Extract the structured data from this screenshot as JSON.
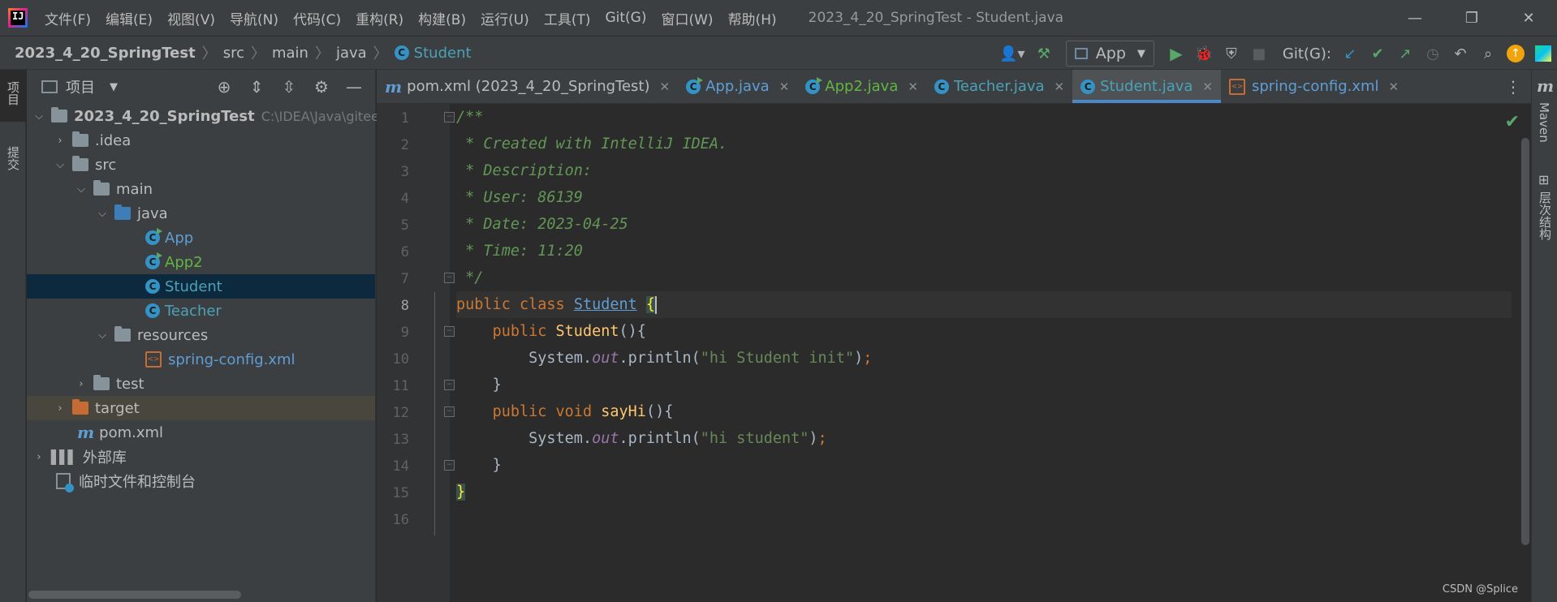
{
  "menubar": {
    "items": [
      "文件(F)",
      "编辑(E)",
      "视图(V)",
      "导航(N)",
      "代码(C)",
      "重构(R)",
      "构建(B)",
      "运行(U)",
      "工具(T)",
      "Git(G)",
      "窗口(W)",
      "帮助(H)"
    ],
    "title": "2023_4_20_SpringTest - Student.java",
    "minimize": "—",
    "restore": "❐",
    "close": "✕"
  },
  "breadcrumb": {
    "project": "2023_4_20_SpringTest",
    "items": [
      "src",
      "main",
      "java"
    ],
    "current": "Student"
  },
  "toolbar": {
    "run_config": "App",
    "git_label": "Git(G):"
  },
  "left_strip": {
    "project_tab": "项目",
    "commit_tab": "提交"
  },
  "right_strip": {
    "maven_tab": "Maven",
    "structure_tab": "层次结构"
  },
  "project_panel": {
    "title": "项目",
    "root_name": "2023_4_20_SpringTest",
    "root_path": "C:\\IDEA\\Java\\gitee",
    "nodes": {
      "idea": ".idea",
      "src": "src",
      "main": "main",
      "java": "java",
      "app": "App",
      "app2": "App2",
      "student": "Student",
      "teacher": "Teacher",
      "resources": "resources",
      "spring_config": "spring-config.xml",
      "test": "test",
      "target": "target",
      "pom": "pom.xml",
      "external_libs": "外部库",
      "scratches": "临时文件和控制台"
    }
  },
  "tabs": [
    {
      "label": "pom.xml (2023_4_20_SpringTest)",
      "icon": "maven-icon"
    },
    {
      "label": "App.java",
      "icon": "class-run-icon"
    },
    {
      "label": "App2.java",
      "icon": "class-run-icon"
    },
    {
      "label": "Teacher.java",
      "icon": "class-icon"
    },
    {
      "label": "Student.java",
      "icon": "class-icon",
      "active": true
    },
    {
      "label": "spring-config.xml",
      "icon": "xml-icon"
    }
  ],
  "editor": {
    "line_numbers": [
      "1",
      "2",
      "3",
      "4",
      "5",
      "6",
      "7",
      "8",
      "9",
      "10",
      "11",
      "12",
      "13",
      "14",
      "15",
      "16"
    ],
    "current_line": 8,
    "comment": {
      "l1": "/**",
      "l2": " * Created with IntelliJ IDEA.",
      "l3": " * Description:",
      "l4": " * User: 86139",
      "l5": " * Date: 2023-04-25",
      "l6": " * Time: 11:20",
      "l7": " */"
    },
    "kw_public": "public",
    "kw_class": "class",
    "kw_void": "void",
    "class_name": "Student",
    "method_say_hi": "sayHi",
    "system": "System",
    "out": "out",
    "println": "println",
    "str_init": "\"hi Student init\"",
    "str_hi": "\"hi student\""
  },
  "watermark": "CSDN @Splice",
  "colors": {
    "accent": "#4a88c7",
    "keyword": "#cc7832",
    "comment": "#629755",
    "string": "#6a8759"
  }
}
